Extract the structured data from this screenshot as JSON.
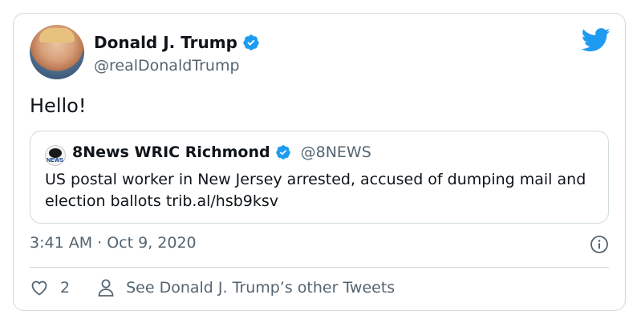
{
  "tweet": {
    "author_name": "Donald J. Trump",
    "author_handle": "@realDonaldTrump",
    "text": "Hello!",
    "timestamp": "3:41 AM · Oct 9, 2020",
    "like_count": "2",
    "see_more_label": "See Donald J. Trump’s other Tweets"
  },
  "quote": {
    "author_name": "8News WRIC Richmond",
    "author_handle": "@8NEWS",
    "text": "US postal worker in New Jersey arrested, accused of dumping mail and election ballots trib.al/hsb9ksv",
    "avatar_text": "NEWS"
  },
  "icons": {
    "verified": "verified-badge-icon",
    "bird": "twitter-bird-icon",
    "info": "info-icon",
    "like": "heart-icon",
    "profile": "person-icon"
  },
  "colors": {
    "brand_blue": "#1d9bf0",
    "text_primary": "#0f1419",
    "text_secondary": "#536471",
    "border": "#cfd9de"
  }
}
